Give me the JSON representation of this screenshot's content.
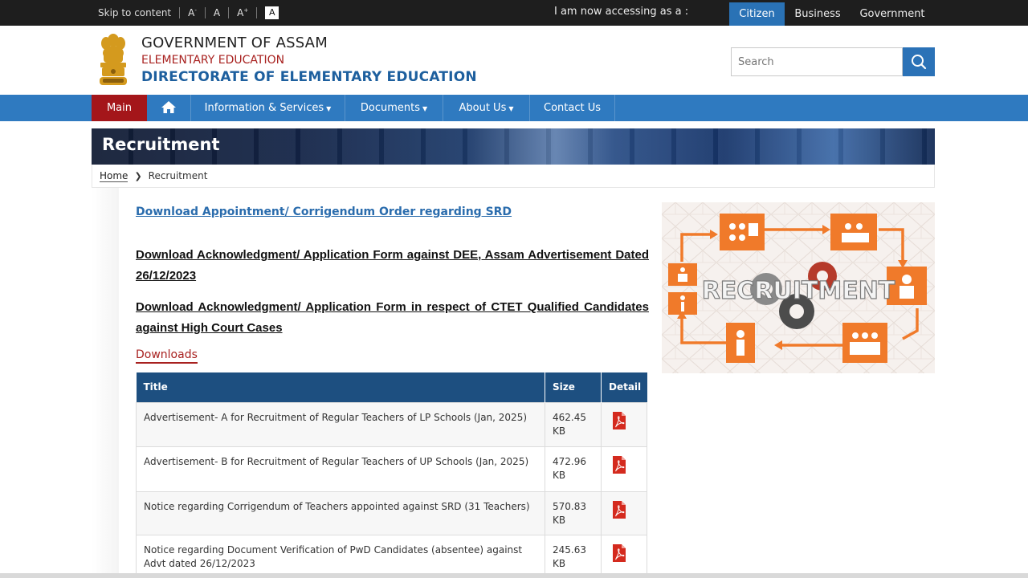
{
  "topbar": {
    "skip": "Skip to content",
    "font_decrease": "A",
    "font_normal": "A",
    "font_increase": "A",
    "contrast": "A",
    "accessing": "I am now accessing as a :",
    "audiences": [
      "Citizen",
      "Business",
      "Government"
    ],
    "active_audience": "Citizen"
  },
  "header": {
    "line1": "GOVERNMENT OF ASSAM",
    "line2": "ELEMENTARY EDUCATION",
    "line3": "DIRECTORATE OF ELEMENTARY EDUCATION",
    "search_placeholder": "Search"
  },
  "nav": {
    "items": [
      "Main",
      "Information & Services",
      "Documents",
      "About Us",
      "Contact Us"
    ]
  },
  "page": {
    "title": "Recruitment",
    "breadcrumb": [
      "Home",
      "Recruitment"
    ]
  },
  "content": {
    "link_srd": "Download Appointment/ Corrigendum Order regarding SRD",
    "link_ack_dee": "Download Acknowledgment/ Application Form against DEE, Assam Advertisement Dated 26/12/2023",
    "link_ack_ctet": "Download Acknowledgment/ Application Form in respect of CTET Qualified Candidates against High Court Cases",
    "downloads_heading": "Downloads",
    "table": {
      "headers": [
        "Title",
        "Size",
        "Detail"
      ],
      "rows": [
        {
          "title": "Advertisement- A for Recruitment of Regular Teachers of LP Schools (Jan, 2025)",
          "size_value": "462.45",
          "size_unit": "KB"
        },
        {
          "title": "Advertisement- B for Recruitment of Regular Teachers of UP Schools (Jan, 2025)",
          "size_value": "472.96",
          "size_unit": "KB"
        },
        {
          "title": "Notice regarding Corrigendum of Teachers appointed against SRD (31 Teachers)",
          "size_value": "570.83",
          "size_unit": "KB"
        },
        {
          "title": "Notice regarding Document Verification of PwD Candidates (absentee) against Advt dated 26/12/2023",
          "size_value": "245.63",
          "size_unit": "KB"
        }
      ]
    }
  },
  "side_image": {
    "text": "RECRUITMENT"
  },
  "colors": {
    "topbar_bg": "#1e1e1e",
    "nav_bg": "#2f7ac0",
    "nav_active": "#a4161a",
    "table_header": "#1d4f80",
    "accent_red": "#a8211f",
    "accent_blue": "#1d5f9e",
    "infographic_orange": "#f07a2a"
  },
  "icons": {
    "home": "home-icon",
    "search": "search-icon",
    "pdf": "pdf-icon",
    "emblem": "assam-emblem-icon"
  }
}
